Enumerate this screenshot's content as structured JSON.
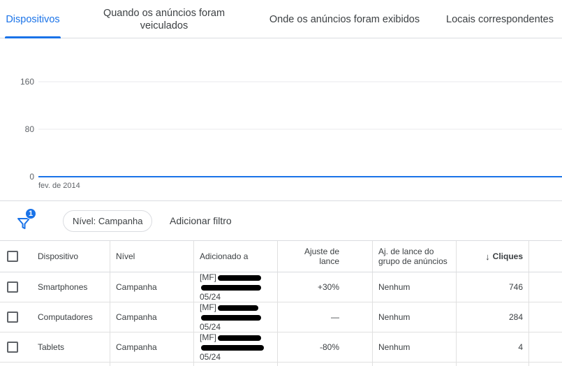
{
  "tabs": [
    {
      "label": "Dispositivos",
      "active": true
    },
    {
      "label": "Quando os anúncios foram veiculados",
      "active": false
    },
    {
      "label": "Onde os anúncios foram exibidos",
      "active": false
    },
    {
      "label": "Locais correspondentes",
      "active": false
    }
  ],
  "chart_data": {
    "type": "line",
    "y_ticks": [
      "160",
      "80",
      "0"
    ],
    "x_tick_label": "fev. de 2014",
    "ylim": [
      0,
      160
    ],
    "series": [
      {
        "values": [
          0,
          0
        ]
      }
    ],
    "grid": true,
    "line_color": "#1a73e8"
  },
  "filters": {
    "badge_count": "1",
    "chip_label": "Nível: Campanha",
    "add_filter_label": "Adicionar filtro"
  },
  "table": {
    "headers": {
      "device": "Dispositivo",
      "level": "Nível",
      "added_to": "Adicionado a",
      "bid_adjust": "Ajuste de lance",
      "ad_group_bid_adjust": "Aj. de lance do grupo de anúncios",
      "clicks": "Cliques"
    },
    "rows": [
      {
        "device": "Smartphones",
        "level": "Campanha",
        "added_line1": "[MF]",
        "added_line2": "",
        "added_line3": "05/24",
        "bid_adjust": "+30%",
        "ad_group": "Nenhum",
        "clicks": "746"
      },
      {
        "device": "Computadores",
        "level": "Campanha",
        "added_line1": "[MF]",
        "added_line2": "",
        "added_line3": "05/24",
        "bid_adjust": "—",
        "ad_group": "Nenhum",
        "clicks": "284"
      },
      {
        "device": "Tablets",
        "level": "Campanha",
        "added_line1": "[MF]",
        "added_line2": "",
        "added_line3": "05/24",
        "bid_adjust": "-80%",
        "ad_group": "Nenhum",
        "clicks": "4"
      }
    ]
  },
  "colors": {
    "accent": "#1a73e8",
    "text": "#3c4043",
    "border": "#dadce0"
  }
}
